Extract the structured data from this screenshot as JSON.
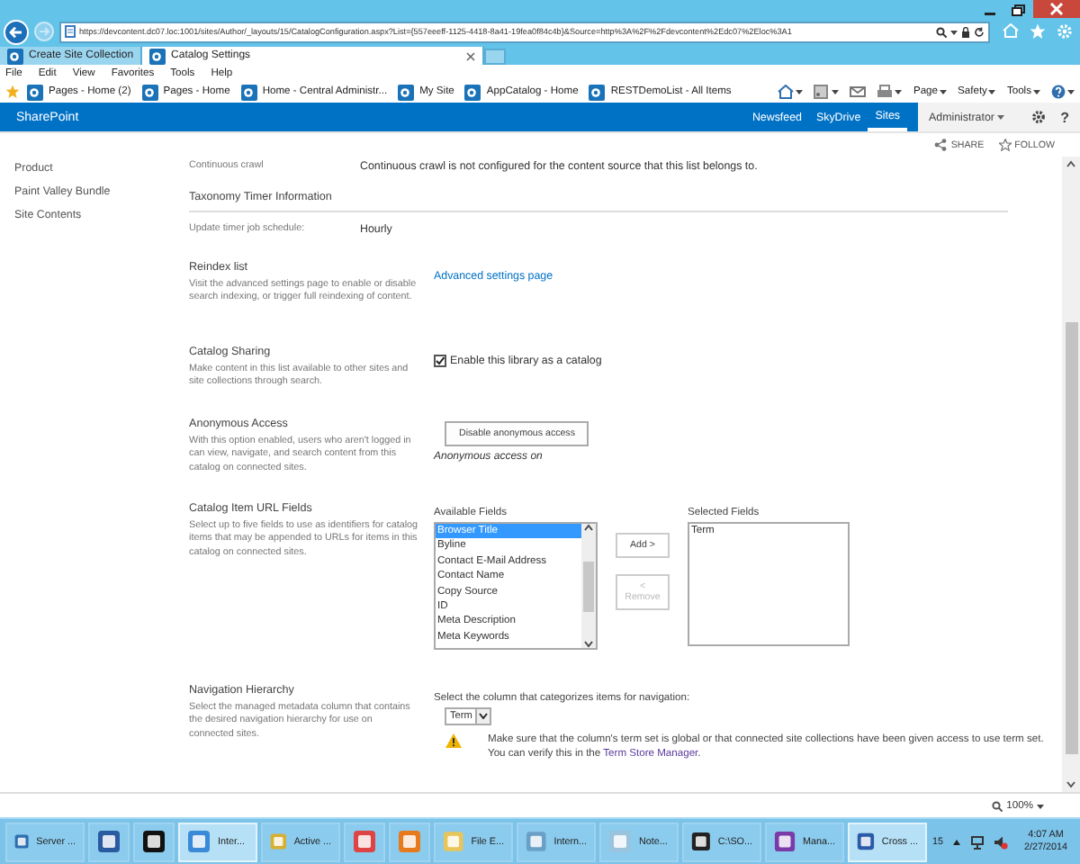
{
  "browser": {
    "url": "https://devcontent.dc07.loc:1001/sites/Author/_layouts/15/CatalogConfiguration.aspx?List={557eeeff-1125-4418-8a41-19fea0f84c4b}&Source=http%3A%2F%2Fdevcontent%2Edc07%2Eloc%3A1",
    "tabs": [
      {
        "label": "Create Site Collection",
        "selected": false
      },
      {
        "label": "Catalog Settings",
        "selected": true
      }
    ],
    "menu": [
      "File",
      "Edit",
      "View",
      "Favorites",
      "Tools",
      "Help"
    ],
    "favorites": [
      "Pages - Home (2)",
      "Pages - Home",
      "Home - Central Administr...",
      "My Site",
      "AppCatalog - Home",
      "RESTDemoList - All Items"
    ],
    "commands": [
      "Page",
      "Safety",
      "Tools"
    ]
  },
  "suite_bar": {
    "brand": "SharePoint",
    "links": [
      {
        "label": "Newsfeed",
        "selected": false
      },
      {
        "label": "SkyDrive",
        "selected": false
      },
      {
        "label": "Sites",
        "selected": true
      }
    ],
    "user": "Administrator",
    "help": "?"
  },
  "actions": [
    "SHARE",
    "FOLLOW"
  ],
  "left_nav": [
    "Product",
    "Paint Valley Bundle",
    "Site Contents"
  ],
  "crawl": {
    "label": "Continuous crawl",
    "value": "Continuous crawl is not configured for the content source that this list belongs to."
  },
  "taxonomy": {
    "title": "Taxonomy Timer Information",
    "label": "Update timer job schedule:",
    "value": "Hourly"
  },
  "sections": [
    {
      "kind": "link",
      "title": "Reindex list",
      "description": "Visit the advanced settings page to enable or disable search indexing, or trigger full reindexing of content.",
      "link": "Advanced settings page"
    },
    {
      "kind": "checkbox",
      "title": "Catalog Sharing",
      "description": "Make content in this list available to other sites and site collections through search.",
      "label": "Enable this library as a catalog",
      "checked": true
    },
    {
      "kind": "button",
      "title": "Anonymous Access",
      "description": "With this option enabled, users who aren't logged in can view, navigate, and search content from this catalog on connected sites.",
      "button": "Disable anonymous access",
      "status": "Anonymous access on"
    },
    {
      "kind": "picker",
      "title": "Catalog Item URL Fields",
      "description": "Select up to five fields to use as identifiers for catalog items that may be appended to URLs for items in this catalog on connected sites.",
      "available_label": "Available Fields",
      "available": [
        {
          "label": "Browser Title",
          "selected": true
        },
        {
          "label": "Byline",
          "selected": false
        },
        {
          "label": "Contact E-Mail Address",
          "selected": false
        },
        {
          "label": "Contact Name",
          "selected": false
        },
        {
          "label": "Copy Source",
          "selected": false
        },
        {
          "label": "ID",
          "selected": false
        },
        {
          "label": "Meta Description",
          "selected": false
        },
        {
          "label": "Meta Keywords",
          "selected": false
        }
      ],
      "add": "Add >",
      "remove": "< Remove",
      "remove_disabled": true,
      "selected_label": "Selected Fields",
      "selected_items": [
        "Term"
      ]
    },
    {
      "kind": "navigation",
      "title": "Navigation Hierarchy",
      "description": "Select the managed metadata column that contains the desired navigation hierarchy for use on connected sites.",
      "prompt": "Select the column that categorizes items for navigation:",
      "dropdown": "Term",
      "warning": "Make sure that the column's term set is global or that connected site collections have been given access to use term set. You can verify this in the ",
      "warning_link": "Term Store Manager",
      "warning_end": "."
    }
  ],
  "status_bar": {
    "zoom": "100%"
  },
  "taskbar": {
    "items": [
      {
        "kind": "labeled",
        "label": "Server ...",
        "selected": false
      },
      {
        "kind": "icon",
        "selected": false
      },
      {
        "kind": "icon",
        "selected": false
      },
      {
        "kind": "labeled",
        "label": "Inter...",
        "selected": true
      },
      {
        "kind": "labeled",
        "label": "Active ...",
        "selected": false
      },
      {
        "kind": "icon",
        "selected": false
      },
      {
        "kind": "icon",
        "selected": false
      },
      {
        "kind": "labeled",
        "label": "File E...",
        "selected": false
      },
      {
        "kind": "labeled",
        "label": "Intern...",
        "selected": false
      },
      {
        "kind": "labeled",
        "label": "Note...",
        "selected": false
      },
      {
        "kind": "labeled",
        "label": "C:\\SO...",
        "selected": false
      },
      {
        "kind": "labeled",
        "label": "Mana...",
        "selected": false
      },
      {
        "kind": "labeled",
        "label": "Cross ...",
        "selected": true
      }
    ],
    "tray_count": "15",
    "time": "4:07 AM",
    "date": "2/27/2014"
  }
}
